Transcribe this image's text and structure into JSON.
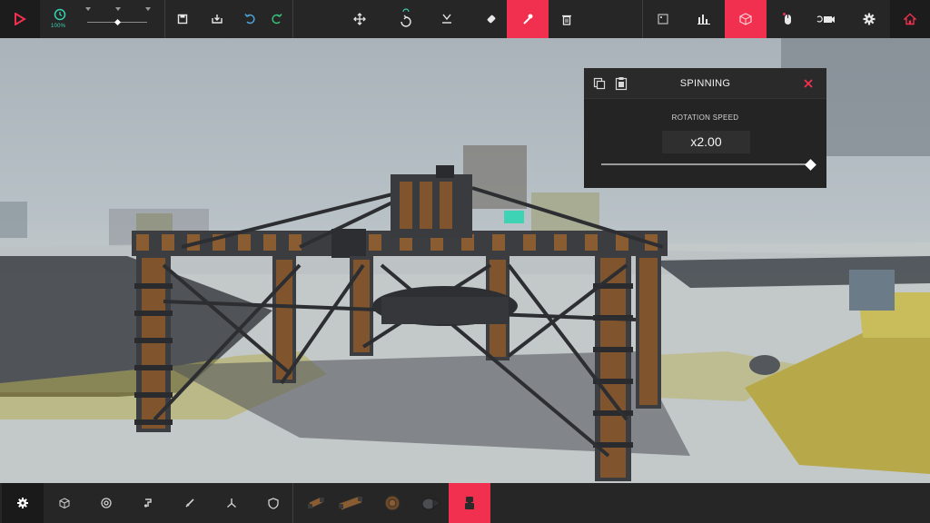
{
  "toolbar": {
    "time_scale": "100%",
    "slider_value": 0.5
  },
  "panel": {
    "title": "SPINNING",
    "setting_label": "ROTATION SPEED",
    "setting_value": "x2.00",
    "slider_value": 1.0
  },
  "colors": {
    "accent": "#f0304e",
    "teal": "#38d3b0",
    "bar_bg": "#262626"
  },
  "icons": {
    "top_left": [
      "play-icon",
      "clock-icon"
    ],
    "file_tools": [
      "save-icon",
      "load-icon",
      "undo-icon",
      "redo-icon"
    ],
    "transform_tools": [
      "move-icon",
      "rotate-icon",
      "flip-icon",
      "eraser-icon",
      "wrench-icon",
      "trash-icon"
    ],
    "right_tools": [
      "info-icon",
      "stats-icon",
      "block-icon",
      "mouse-icon",
      "camera-icon",
      "settings-icon",
      "home-icon"
    ],
    "categories": [
      "basic-icon",
      "blocks-icon",
      "wheels-icon",
      "mechanical-icon",
      "weapons-icon",
      "flight-icon",
      "armour-icon"
    ],
    "parts": [
      "small-log-icon",
      "log-icon",
      "wheel-block-icon",
      "steering-block-icon",
      "spinning-block-icon"
    ]
  }
}
